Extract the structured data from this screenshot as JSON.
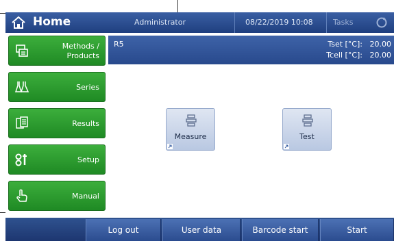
{
  "header": {
    "title": "Home",
    "user": "Administrator",
    "datetime": "08/22/2019 10:08",
    "tasks_label": "Tasks",
    "home_icon": "home-icon",
    "refresh_icon": "refresh-icon"
  },
  "nav": {
    "items": [
      {
        "label_line1": "Methods /",
        "label_line2": "Products",
        "icon": "methods-products-icon"
      },
      {
        "label": "Series",
        "icon": "flasks-icon"
      },
      {
        "label": "Results",
        "icon": "results-icon"
      },
      {
        "label": "Setup",
        "icon": "setup-icon"
      },
      {
        "label": "Manual",
        "icon": "hand-pointer-icon"
      }
    ]
  },
  "info": {
    "method_name": "R5",
    "tset_label": "Tset [°C]:",
    "tset_value": "20.00",
    "tcell_label": "Tcell [°C]:",
    "tcell_value": "20.00"
  },
  "tiles": [
    {
      "label": "Measure",
      "icon": "method-icon"
    },
    {
      "label": "Test",
      "icon": "method-icon"
    }
  ],
  "footer": {
    "logout": "Log out",
    "user_data": "User data",
    "barcode_start": "Barcode start",
    "start": "Start"
  },
  "colors": {
    "title_bar": "#2a4c8f",
    "nav_green": "#2a9c2e",
    "tile_bg": "#cdd8ec"
  }
}
